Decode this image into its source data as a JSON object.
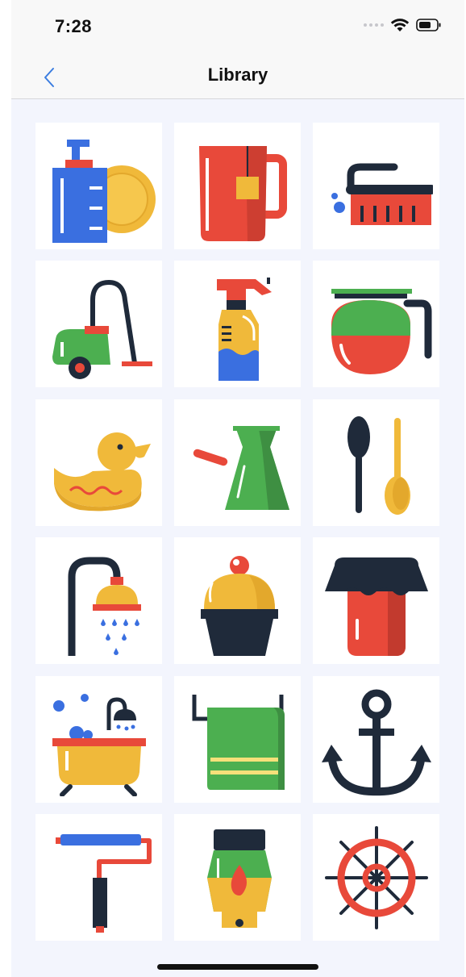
{
  "status_bar": {
    "time": "7:28"
  },
  "nav": {
    "title": "Library"
  },
  "library": {
    "items": [
      {
        "icon": "dish-soap-icon"
      },
      {
        "icon": "mug-icon"
      },
      {
        "icon": "scrub-brush-icon"
      },
      {
        "icon": "vacuum-cleaner-icon"
      },
      {
        "icon": "spray-bottle-icon"
      },
      {
        "icon": "coffee-pot-icon"
      },
      {
        "icon": "rubber-duck-icon"
      },
      {
        "icon": "coffee-cezve-icon"
      },
      {
        "icon": "spoons-icon"
      },
      {
        "icon": "shower-head-icon"
      },
      {
        "icon": "cupcake-icon"
      },
      {
        "icon": "jam-jar-icon"
      },
      {
        "icon": "bathtub-icon"
      },
      {
        "icon": "towel-icon"
      },
      {
        "icon": "anchor-icon"
      },
      {
        "icon": "paint-roller-icon"
      },
      {
        "icon": "lantern-icon"
      },
      {
        "icon": "ship-wheel-icon"
      }
    ]
  },
  "colors": {
    "blue": "#3a6fe0",
    "red": "#e8493a",
    "yellow": "#f0b93a",
    "green": "#4caf50",
    "navy": "#1f2a3a",
    "background": "#f3f5fd"
  }
}
